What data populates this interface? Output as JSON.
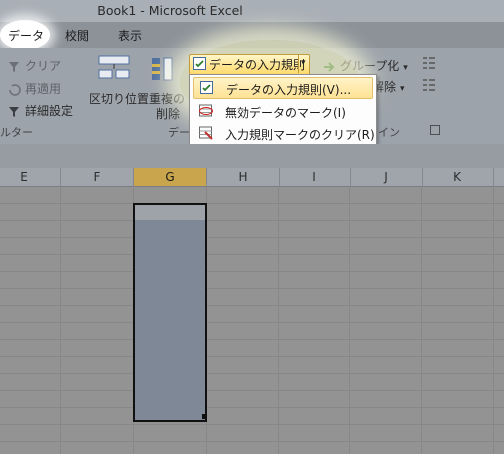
{
  "window": {
    "title": "Book1 - Microsoft Excel"
  },
  "tabs": [
    {
      "label": "データ"
    },
    {
      "label": "校閲"
    },
    {
      "label": "表示"
    }
  ],
  "ribbon": {
    "filter_group": {
      "clear_label": "クリア",
      "reapply_label": "再適用",
      "advanced_label": "詳細設定",
      "group_label": "ルター"
    },
    "text_to_columns_label": "区切り位置",
    "remove_duplicates_label_1": "重複の",
    "remove_duplicates_label_2": "削除",
    "data_tools_group_label": "デー",
    "group_button_label": "グループ化",
    "ungroup_button_label": "解除",
    "outline_group_label": "イン"
  },
  "data_validation": {
    "button_label": "データの入力規則",
    "menu": [
      {
        "label": "データの入力規則(V)..."
      },
      {
        "label": "無効データのマーク(I)"
      },
      {
        "label": "入力規則マークのクリア(R)"
      }
    ]
  },
  "sheet": {
    "columns": [
      "E",
      "F",
      "G",
      "H",
      "I",
      "J",
      "K"
    ],
    "selected_column": "G"
  },
  "colors": {
    "selected_column_header": "#c9a64d",
    "selection_fill": "#7f8896",
    "highlight_glow": "#ffffdc"
  }
}
